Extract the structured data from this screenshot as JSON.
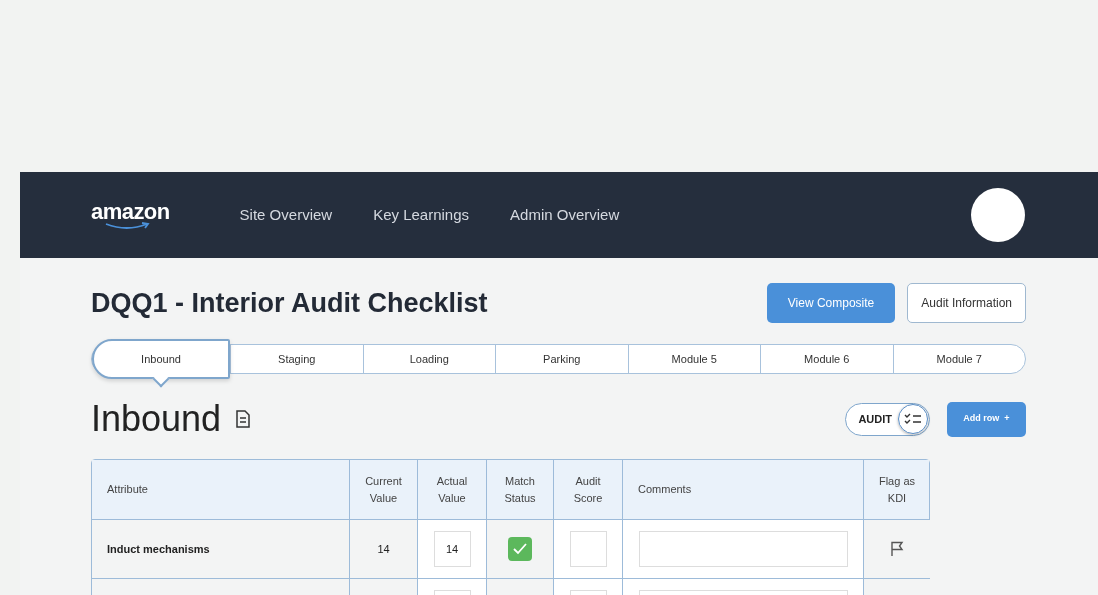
{
  "header": {
    "logo": "amazon",
    "nav": [
      "Site Overview",
      "Key Learnings",
      "Admin Overview"
    ]
  },
  "title": "DQQ1 - Interior Audit Checklist",
  "actions": [
    "View Composite",
    "Audit Information"
  ],
  "tabs": [
    {
      "label": "Inbound",
      "selected": true
    },
    {
      "label": "Staging",
      "selected": false
    },
    {
      "label": "Loading",
      "selected": false
    },
    {
      "label": "Parking",
      "selected": false
    },
    {
      "label": "Module 5",
      "selected": false
    },
    {
      "label": "Module 6",
      "selected": false
    },
    {
      "label": "Module 7",
      "selected": false
    }
  ],
  "section": {
    "heading": "Inbound",
    "audit_toggle": {
      "label": "AUDIT",
      "on": true
    },
    "add_button": "Add row  +"
  },
  "table": {
    "columns": [
      "Attribute",
      "Current Value",
      "Actual Value",
      "Match Status",
      "Audit Score",
      "Comments",
      "Flag as KDI"
    ],
    "rows": [
      {
        "kind": "entry",
        "attribute": "Induct mechanisms",
        "current": "14",
        "actual": "14",
        "match": true
      },
      {
        "kind": "blank"
      }
    ]
  }
}
